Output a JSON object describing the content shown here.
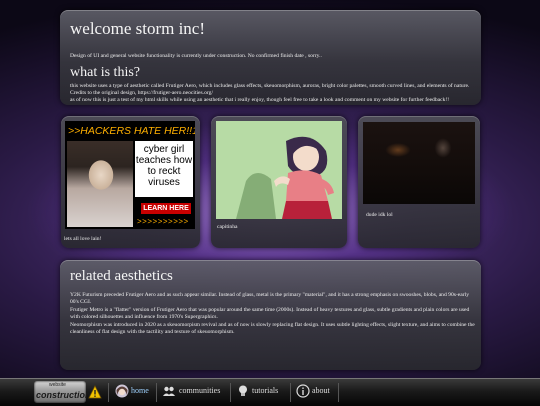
{
  "welcome": {
    "title": "welcome storm inc!",
    "notice": "Design of UI and general website functionality is currently under construction. No confirmed finish date , sorry..",
    "what_title": "what is this?",
    "what_text_1": "this website uses a type of aesthetic called Frutiger Aero, which includes glass effects, skeuomorphism, auroras, bright color palettes, smooth curved lines, and elements of nature. Credits to the original design, https://frutiger-aero.neocities.org/",
    "what_text_2": "as of now this is just a test of my html skills while using an aesthetic that i really enjoy, though feel free to take a look and comment on my website for further feedback!!"
  },
  "cards": [
    {
      "ad_headline": ">>HACKERS HATE HER!!1",
      "ad_text": "cyber girl teaches how to reckt viruses",
      "ad_button": "LEARN HERE",
      "ad_arrows": ">>>>>>>>>>",
      "caption": "lets all love lain!"
    },
    {
      "caption": "capitinha"
    },
    {
      "caption": "dude idk lol"
    }
  ],
  "related": {
    "title": "related aesthetics",
    "p1": "Y2K Futurism preceded Frutiger Aero and as such appear similar. Instead of glass, metal is the primary \"material\", and it has a strong emphasis on swooshes, blobs, and 90s-early 00's CGI.",
    "p2": "Frutiger Metro is a \"flatter\" version of Frutiger Aero that was popular around the same time (2000s). Instead of heavy textures and glass, subtle gradients and plain colors are used with colored silhouettes and influence from 1970's Supergraphics.",
    "p3": "Neomorphism was introduced in 2020 as a skeuomorpism revival and as of now is slowly replacing flat design. It uses subtle lighting effects, slight texture, and aims to combine the cleanliness of flat design with the tactility and texture of skeuomorphism."
  },
  "taskbar": {
    "logo_top": "website",
    "logo_main": "construction",
    "home": "home",
    "communities": "communities",
    "tutorials": "tutorials",
    "about": "about"
  },
  "icons": [
    "warning-icon",
    "lain-icon",
    "people-icon",
    "lightbulb-icon",
    "info-icon"
  ]
}
